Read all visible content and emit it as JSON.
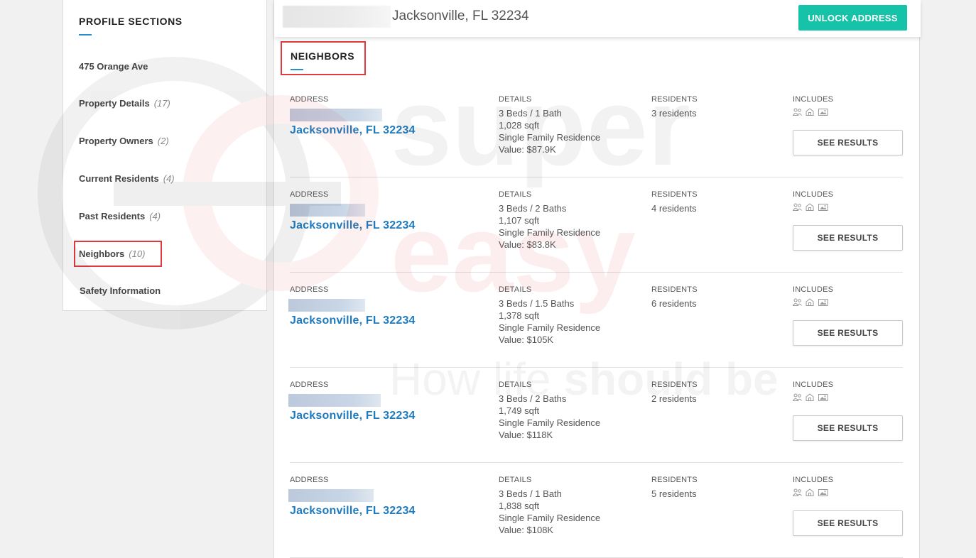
{
  "sidebar": {
    "title": "PROFILE SECTIONS",
    "items": [
      {
        "label": "475 Orange Ave",
        "count": ""
      },
      {
        "label": "Property Details",
        "count": "(17)"
      },
      {
        "label": "Property Owners",
        "count": "(2)"
      },
      {
        "label": "Current Residents",
        "count": "(4)"
      },
      {
        "label": "Past Residents",
        "count": "(4)"
      },
      {
        "label": "Neighbors",
        "count": "(10)"
      },
      {
        "label": "Safety Information",
        "count": ""
      }
    ]
  },
  "topbar": {
    "address": "Jacksonville, FL 32234",
    "unlock_label": "UNLOCK ADDRESS"
  },
  "section": {
    "title": "NEIGHBORS"
  },
  "columns": {
    "address": "ADDRESS",
    "details": "DETAILS",
    "residents": "RESIDENTS",
    "includes": "INCLUDES"
  },
  "neighbors": [
    {
      "city": "Jacksonville, FL 32234",
      "beds_baths": "3 Beds / 1 Bath",
      "sqft": "1,028 sqft",
      "type": "Single Family Residence",
      "value": "Value: $87.9K",
      "residents": "3 residents",
      "button": "SEE RESULTS"
    },
    {
      "city": "Jacksonville, FL 32234",
      "beds_baths": "3 Beds / 2 Baths",
      "sqft": "1,107 sqft",
      "type": "Single Family Residence",
      "value": "Value: $83.8K",
      "residents": "4 residents",
      "button": "SEE RESULTS"
    },
    {
      "city": "Jacksonville, FL 32234",
      "beds_baths": "3 Beds / 1.5 Baths",
      "sqft": "1,378 sqft",
      "type": "Single Family Residence",
      "value": "Value: $105K",
      "residents": "6 residents",
      "button": "SEE RESULTS"
    },
    {
      "city": "Jacksonville, FL 32234",
      "beds_baths": "3 Beds / 2 Baths",
      "sqft": "1,749 sqft",
      "type": "Single Family Residence",
      "value": "Value: $118K",
      "residents": "2 residents",
      "button": "SEE RESULTS"
    },
    {
      "city": "Jacksonville, FL 32234",
      "beds_baths": "3 Beds / 1 Bath",
      "sqft": "1,838 sqft",
      "type": "Single Family Residence",
      "value": "Value: $108K",
      "residents": "5 residents",
      "button": "SEE RESULTS"
    }
  ],
  "includes_icons": [
    "people-icon",
    "house-icon",
    "photo-icon"
  ],
  "watermark": {
    "line1": "super",
    "line2": "easy",
    "tagline_light": "How life ",
    "tagline_bold": "should be"
  },
  "colors": {
    "accent": "#16c3a8",
    "link": "#1f7bbf",
    "highlight": "#e0393e",
    "underline": "#2a8fc8"
  }
}
